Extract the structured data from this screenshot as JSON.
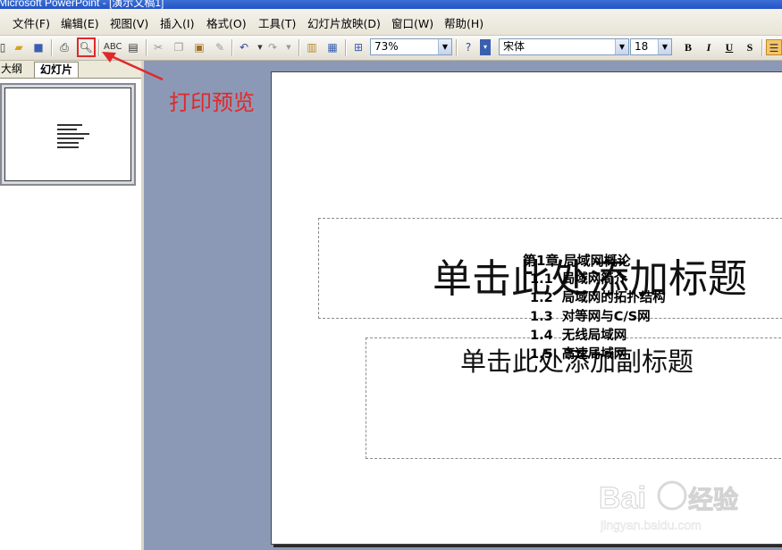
{
  "window": {
    "title": "Microsoft PowerPoint - [演示文稿1]"
  },
  "menubar": {
    "items": [
      "文件(F)",
      "编辑(E)",
      "视图(V)",
      "插入(I)",
      "格式(O)",
      "工具(T)",
      "幻灯片放映(D)",
      "窗口(W)",
      "帮助(H)"
    ]
  },
  "toolbar": {
    "zoom": "73%",
    "font_name": "宋体",
    "font_size": "18",
    "bold": "B",
    "italic": "I",
    "underline": "U",
    "shadow": "S",
    "icons": [
      "new-icon",
      "open-icon",
      "save-icon",
      "print-icon",
      "print-preview-icon",
      "spelling-icon",
      "research-icon",
      "cut-icon",
      "copy-icon",
      "paste-icon",
      "format-painter-icon",
      "undo-icon",
      "redo-icon",
      "chart-icon",
      "table-icon",
      "grid-icon",
      "help-icon"
    ]
  },
  "left_pane": {
    "tabs": [
      "大纲",
      "幻灯片"
    ],
    "active_tab": "幻灯片"
  },
  "slide": {
    "title_placeholder": "单击此处添加标题",
    "subtitle_placeholder": "单击此处添加副标题",
    "chapter": "第1章 局域网概论",
    "outline": [
      {
        "num": "1.1",
        "text": "局域网简介"
      },
      {
        "num": "1.2",
        "text": "局域网的拓扑结构"
      },
      {
        "num": "1.3",
        "text": "对等网与C/S网"
      },
      {
        "num": "1.4",
        "text": "无线局域网"
      },
      {
        "num": "1.5",
        "text": "高速局域网"
      }
    ]
  },
  "annotation": {
    "text": "打印预览",
    "color": "#e0282b"
  },
  "watermark": {
    "text": "Bai经验",
    "subtext": "jingyan.baidu.com"
  }
}
